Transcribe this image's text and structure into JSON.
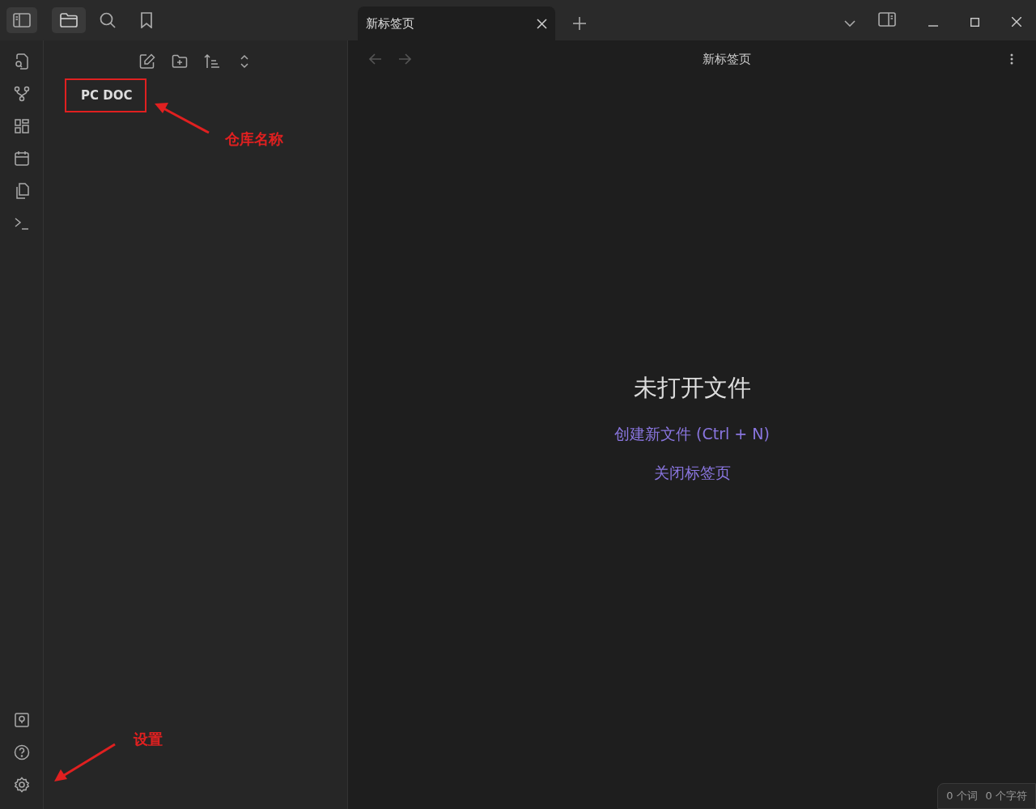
{
  "sidebar_tabs": [
    {
      "selected": true
    },
    {
      "selected": false
    },
    {
      "selected": false
    }
  ],
  "tabs": [
    {
      "title": "新标签页",
      "selected": true
    }
  ],
  "file_explorer": {
    "vault_name": "PC DOC"
  },
  "view": {
    "title": "新标签页",
    "empty_state": {
      "heading": "未打开文件",
      "actions": [
        "创建新文件 (Ctrl + N)",
        "关闭标签页"
      ]
    }
  },
  "status_bar": {
    "words": "0 个词",
    "characters": "0 个字符"
  },
  "annotations": [
    {
      "label": "仓库名称"
    },
    {
      "label": "设置"
    }
  ]
}
